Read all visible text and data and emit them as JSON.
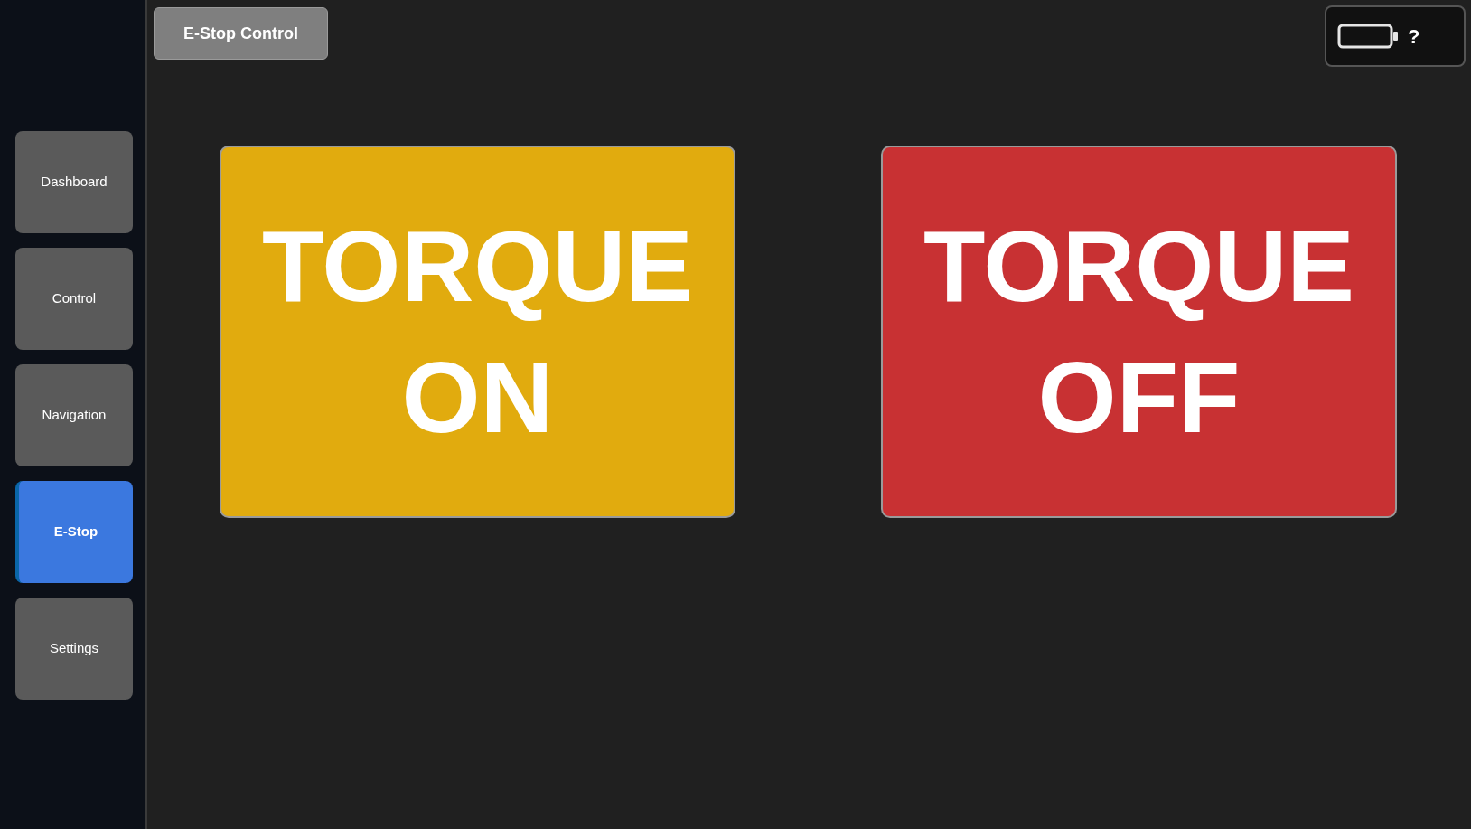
{
  "sidebar": {
    "items": [
      {
        "label": "Dashboard",
        "selected": false
      },
      {
        "label": "Control",
        "selected": false
      },
      {
        "label": "Navigation",
        "selected": false
      },
      {
        "label": "E-Stop",
        "selected": true
      },
      {
        "label": "Settings",
        "selected": false
      }
    ]
  },
  "header": {
    "title_button": "E-Stop Control",
    "battery": {
      "reading": "?"
    }
  },
  "torque_buttons": [
    {
      "label": "TORQUE ON",
      "kind": "on"
    },
    {
      "label": "TORQUE OFF",
      "kind": "off"
    }
  ]
}
